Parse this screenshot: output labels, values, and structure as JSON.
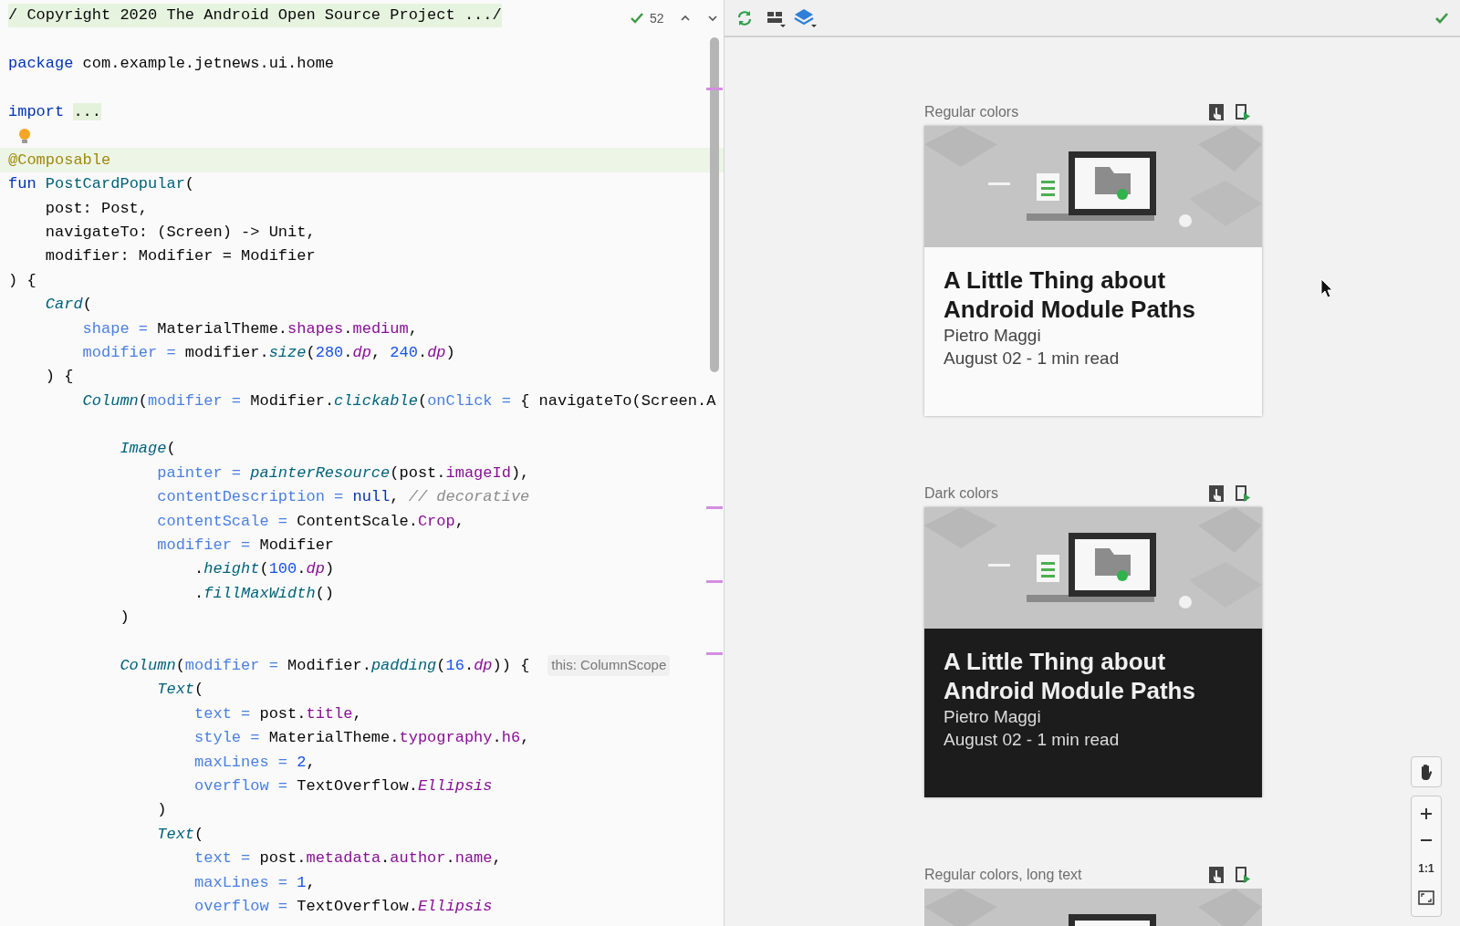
{
  "editor": {
    "inspection": {
      "count": "52"
    },
    "lines": [
      {
        "kind": "folded",
        "tokens": [
          {
            "kind": "plain",
            "text": "/ Copyright 2020 The Android Open Source Project .../"
          }
        ]
      },
      {
        "kind": "blank"
      },
      {
        "kind": "code",
        "tokens": [
          {
            "kind": "kw",
            "text": "package"
          },
          {
            "kind": "plain",
            "text": " com.example.jetnews.ui.home"
          }
        ]
      },
      {
        "kind": "blank"
      },
      {
        "kind": "code",
        "tokens": [
          {
            "kind": "kw",
            "text": "import "
          },
          {
            "kind": "fold",
            "text": "..."
          }
        ]
      },
      {
        "kind": "bulb"
      },
      {
        "kind": "code",
        "current": true,
        "tokens": [
          {
            "kind": "annot",
            "text": "@Composable"
          }
        ]
      },
      {
        "kind": "code",
        "tokens": [
          {
            "kind": "kw",
            "text": "fun "
          },
          {
            "kind": "decl",
            "text": "PostCardPopular"
          },
          {
            "kind": "plain",
            "text": "("
          }
        ]
      },
      {
        "kind": "code",
        "tokens": [
          {
            "kind": "plain",
            "text": "    post: Post,"
          }
        ]
      },
      {
        "kind": "code",
        "tokens": [
          {
            "kind": "plain",
            "text": "    navigateTo: (Screen) -> Unit,"
          }
        ]
      },
      {
        "kind": "code",
        "tokens": [
          {
            "kind": "plain",
            "text": "    modifier: Modifier = Modifier"
          }
        ]
      },
      {
        "kind": "code",
        "tokens": [
          {
            "kind": "plain",
            "text": ") {"
          }
        ]
      },
      {
        "kind": "code",
        "tokens": [
          {
            "kind": "call",
            "text": "    Card"
          },
          {
            "kind": "plain",
            "text": "("
          }
        ]
      },
      {
        "kind": "code",
        "tokens": [
          {
            "kind": "arg",
            "text": "        shape ="
          },
          {
            "kind": "plain",
            "text": " MaterialTheme."
          },
          {
            "kind": "prop",
            "text": "shapes"
          },
          {
            "kind": "plain",
            "text": "."
          },
          {
            "kind": "prop",
            "text": "medium"
          },
          {
            "kind": "plain",
            "text": ","
          }
        ]
      },
      {
        "kind": "code",
        "tokens": [
          {
            "kind": "arg",
            "text": "        modifier ="
          },
          {
            "kind": "plain",
            "text": " modifier."
          },
          {
            "kind": "call",
            "text": "size"
          },
          {
            "kind": "plain",
            "text": "("
          },
          {
            "kind": "num",
            "text": "280"
          },
          {
            "kind": "plain",
            "text": "."
          },
          {
            "kind": "propi",
            "text": "dp"
          },
          {
            "kind": "plain",
            "text": ", "
          },
          {
            "kind": "num",
            "text": "240"
          },
          {
            "kind": "plain",
            "text": "."
          },
          {
            "kind": "propi",
            "text": "dp"
          },
          {
            "kind": "plain",
            "text": ")"
          }
        ]
      },
      {
        "kind": "code",
        "tokens": [
          {
            "kind": "plain",
            "text": "    ) {"
          }
        ]
      },
      {
        "kind": "code",
        "tokens": [
          {
            "kind": "call",
            "text": "        Column"
          },
          {
            "kind": "plain",
            "text": "("
          },
          {
            "kind": "arg",
            "text": "modifier ="
          },
          {
            "kind": "plain",
            "text": " Modifier."
          },
          {
            "kind": "call",
            "text": "clickable"
          },
          {
            "kind": "plain",
            "text": "("
          },
          {
            "kind": "arg",
            "text": "onClick ="
          },
          {
            "kind": "plain",
            "text": " { navigateTo(Screen.A"
          }
        ]
      },
      {
        "kind": "blank"
      },
      {
        "kind": "code",
        "tokens": [
          {
            "kind": "call",
            "text": "            Image"
          },
          {
            "kind": "plain",
            "text": "("
          }
        ]
      },
      {
        "kind": "code",
        "tokens": [
          {
            "kind": "arg",
            "text": "                painter ="
          },
          {
            "kind": "call",
            "text": " painterResource"
          },
          {
            "kind": "plain",
            "text": "(post."
          },
          {
            "kind": "prop",
            "text": "imageId"
          },
          {
            "kind": "plain",
            "text": "),"
          }
        ]
      },
      {
        "kind": "code",
        "tokens": [
          {
            "kind": "arg",
            "text": "                contentDescription ="
          },
          {
            "kind": "kw",
            "text": " null"
          },
          {
            "kind": "plain",
            "text": ", "
          },
          {
            "kind": "comment",
            "text": "// decorative"
          }
        ]
      },
      {
        "kind": "code",
        "tokens": [
          {
            "kind": "arg",
            "text": "                contentScale ="
          },
          {
            "kind": "plain",
            "text": " ContentScale."
          },
          {
            "kind": "prop",
            "text": "Crop"
          },
          {
            "kind": "plain",
            "text": ","
          }
        ]
      },
      {
        "kind": "code",
        "tokens": [
          {
            "kind": "arg",
            "text": "                modifier ="
          },
          {
            "kind": "plain",
            "text": " Modifier"
          }
        ]
      },
      {
        "kind": "code",
        "tokens": [
          {
            "kind": "plain",
            "text": "                    ."
          },
          {
            "kind": "call",
            "text": "height"
          },
          {
            "kind": "plain",
            "text": "("
          },
          {
            "kind": "num",
            "text": "100"
          },
          {
            "kind": "plain",
            "text": "."
          },
          {
            "kind": "propi",
            "text": "dp"
          },
          {
            "kind": "plain",
            "text": ")"
          }
        ]
      },
      {
        "kind": "code",
        "tokens": [
          {
            "kind": "plain",
            "text": "                    ."
          },
          {
            "kind": "call",
            "text": "fillMaxWidth"
          },
          {
            "kind": "plain",
            "text": "()"
          }
        ]
      },
      {
        "kind": "code",
        "tokens": [
          {
            "kind": "plain",
            "text": "            )"
          }
        ]
      },
      {
        "kind": "blank"
      },
      {
        "kind": "code",
        "hint": "this: ColumnScope",
        "tokens": [
          {
            "kind": "call",
            "text": "            Column"
          },
          {
            "kind": "plain",
            "text": "("
          },
          {
            "kind": "arg",
            "text": "modifier ="
          },
          {
            "kind": "plain",
            "text": " Modifier."
          },
          {
            "kind": "call",
            "text": "padding"
          },
          {
            "kind": "plain",
            "text": "("
          },
          {
            "kind": "num",
            "text": "16"
          },
          {
            "kind": "plain",
            "text": "."
          },
          {
            "kind": "propi",
            "text": "dp"
          },
          {
            "kind": "plain",
            "text": ")) {"
          }
        ]
      },
      {
        "kind": "code",
        "tokens": [
          {
            "kind": "call",
            "text": "                Text"
          },
          {
            "kind": "plain",
            "text": "("
          }
        ]
      },
      {
        "kind": "code",
        "tokens": [
          {
            "kind": "arg",
            "text": "                    text ="
          },
          {
            "kind": "plain",
            "text": " post."
          },
          {
            "kind": "prop",
            "text": "title"
          },
          {
            "kind": "plain",
            "text": ","
          }
        ]
      },
      {
        "kind": "code",
        "tokens": [
          {
            "kind": "arg",
            "text": "                    style ="
          },
          {
            "kind": "plain",
            "text": " MaterialTheme."
          },
          {
            "kind": "prop",
            "text": "typography"
          },
          {
            "kind": "plain",
            "text": "."
          },
          {
            "kind": "prop",
            "text": "h6"
          },
          {
            "kind": "plain",
            "text": ","
          }
        ]
      },
      {
        "kind": "code",
        "tokens": [
          {
            "kind": "arg",
            "text": "                    maxLines ="
          },
          {
            "kind": "num",
            "text": " 2"
          },
          {
            "kind": "plain",
            "text": ","
          }
        ]
      },
      {
        "kind": "code",
        "tokens": [
          {
            "kind": "arg",
            "text": "                    overflow ="
          },
          {
            "kind": "plain",
            "text": " TextOverflow."
          },
          {
            "kind": "propi",
            "text": "Ellipsis"
          }
        ]
      },
      {
        "kind": "code",
        "tokens": [
          {
            "kind": "plain",
            "text": "                )"
          }
        ]
      },
      {
        "kind": "code",
        "tokens": [
          {
            "kind": "call",
            "text": "                Text"
          },
          {
            "kind": "plain",
            "text": "("
          }
        ]
      },
      {
        "kind": "code",
        "tokens": [
          {
            "kind": "arg",
            "text": "                    text ="
          },
          {
            "kind": "plain",
            "text": " post."
          },
          {
            "kind": "prop",
            "text": "metadata"
          },
          {
            "kind": "plain",
            "text": "."
          },
          {
            "kind": "prop",
            "text": "author"
          },
          {
            "kind": "plain",
            "text": "."
          },
          {
            "kind": "prop",
            "text": "name"
          },
          {
            "kind": "plain",
            "text": ","
          }
        ]
      },
      {
        "kind": "code",
        "tokens": [
          {
            "kind": "arg",
            "text": "                    maxLines ="
          },
          {
            "kind": "num",
            "text": " 1"
          },
          {
            "kind": "plain",
            "text": ","
          }
        ]
      },
      {
        "kind": "code",
        "tokens": [
          {
            "kind": "arg",
            "text": "                    overflow ="
          },
          {
            "kind": "plain",
            "text": " TextOverflow."
          },
          {
            "kind": "propi",
            "text": "Ellipsis"
          }
        ]
      }
    ]
  },
  "preview": {
    "previews": [
      {
        "label": "Regular colors",
        "dark": false,
        "title": "A Little Thing about Android Module Paths",
        "author": "Pietro Maggi",
        "date": "August 02 - 1 min read"
      },
      {
        "label": "Dark colors",
        "dark": true,
        "title": "A Little Thing about Android Module Paths",
        "author": "Pietro Maggi",
        "date": "August 02 - 1 min read"
      },
      {
        "label": "Regular colors, long text"
      }
    ],
    "zoom_controls": {
      "actual_size": "1:1"
    }
  }
}
